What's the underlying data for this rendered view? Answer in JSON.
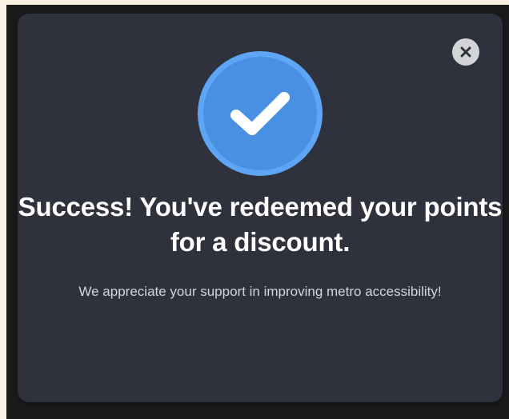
{
  "modal": {
    "close_icon": "close-icon",
    "status_icon": "checkmark-icon",
    "title": "Success! You've redeemed your points for a discount.",
    "message": "We appreciate your support in improving metro accessibility!"
  },
  "colors": {
    "page_background": "#fbf1e3",
    "overlay": "#1b1b1c",
    "modal_background": "#2f313c",
    "accent_blue": "#4a90e2",
    "accent_blue_ring": "#5ea6f5",
    "close_button": "#d3d4d8",
    "title_text": "#ffffff",
    "message_text": "#d4d5da"
  }
}
